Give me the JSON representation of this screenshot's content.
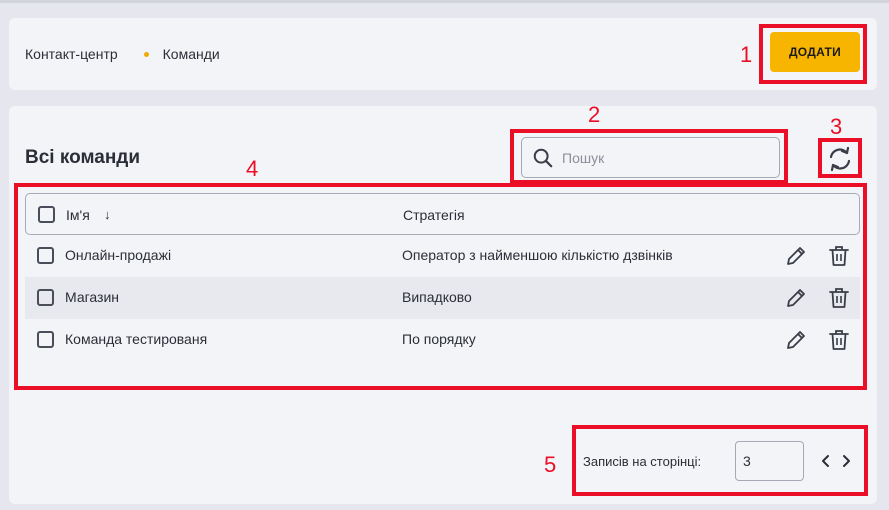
{
  "breadcrumb": {
    "root": "Контакт-центр",
    "current": "Команди"
  },
  "header": {
    "add_label": "ДОДАТИ"
  },
  "main": {
    "title": "Всі команди",
    "search_placeholder": "Пошук"
  },
  "table": {
    "columns": {
      "name": "Ім'я",
      "sort_indicator": "↓",
      "strategy": "Стратегія"
    },
    "rows": [
      {
        "name": "Онлайн-продажі",
        "strategy": "Оператор з найменшою кількістю дзвінків"
      },
      {
        "name": "Магазин",
        "strategy": "Випадково"
      },
      {
        "name": "Команда тестированя",
        "strategy": "По порядку"
      }
    ]
  },
  "pagination": {
    "label": "Записів на сторінці:",
    "value": "3"
  },
  "annotations": [
    "1",
    "2",
    "3",
    "4",
    "5"
  ],
  "colors": {
    "accent": "#f7b500",
    "annotation": "#ea0e26",
    "dot": "#f2a900"
  },
  "icons": [
    "search-icon",
    "refresh-icon",
    "pencil-icon",
    "trash-icon",
    "chevron-left-icon",
    "chevron-right-icon"
  ]
}
